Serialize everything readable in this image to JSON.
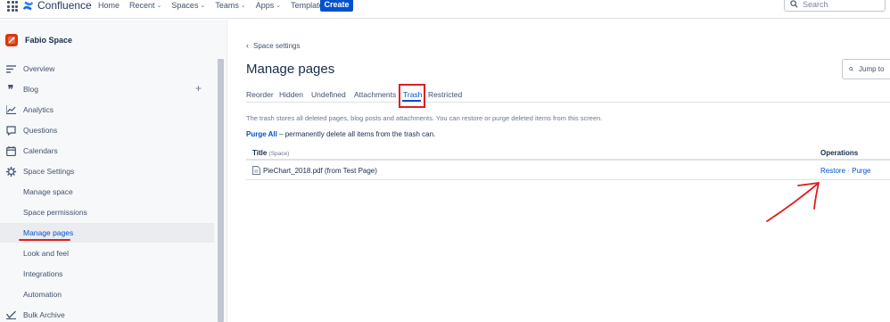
{
  "topnav": {
    "app_name": "Confluence",
    "items": [
      {
        "label": "Home",
        "dropdown": false
      },
      {
        "label": "Recent",
        "dropdown": true
      },
      {
        "label": "Spaces",
        "dropdown": true
      },
      {
        "label": "Teams",
        "dropdown": true
      },
      {
        "label": "Apps",
        "dropdown": true
      },
      {
        "label": "Templates",
        "dropdown": false
      }
    ],
    "create_label": "Create",
    "search_placeholder": "Search"
  },
  "sidebar": {
    "space_name": "Fabio Space",
    "items": [
      {
        "label": "Overview",
        "icon": "overview-icon"
      },
      {
        "label": "Blog",
        "icon": "quote-icon"
      },
      {
        "label": "Analytics",
        "icon": "analytics-icon"
      },
      {
        "label": "Questions",
        "icon": "questions-icon"
      },
      {
        "label": "Calendars",
        "icon": "calendar-icon"
      },
      {
        "label": "Space Settings",
        "icon": "gear-icon"
      },
      {
        "label": "Manage space",
        "icon": ""
      },
      {
        "label": "Space permissions",
        "icon": ""
      },
      {
        "label": "Manage pages",
        "icon": "",
        "active": true
      },
      {
        "label": "Look and feel",
        "icon": ""
      },
      {
        "label": "Integrations",
        "icon": ""
      },
      {
        "label": "Automation",
        "icon": ""
      },
      {
        "label": "Bulk Archive",
        "icon": "archive-icon"
      }
    ]
  },
  "main": {
    "breadcrumb": "Space settings",
    "title": "Manage pages",
    "jump_placeholder": "Jump to",
    "tabs": [
      {
        "label": "Reorder"
      },
      {
        "label": "Hidden"
      },
      {
        "label": "Undefined"
      },
      {
        "label": "Attachments"
      },
      {
        "label": "Trash",
        "active": true
      },
      {
        "label": "Restricted"
      }
    ],
    "description": "The trash stores all deleted pages, blog posts and attachments. You can restore or purge deleted items from this screen.",
    "purge_all_label": "Purge All",
    "purge_all_desc": " – permanently delete all items from the trash can.",
    "table": {
      "col_title": "Title",
      "col_title_sub": "(Space)",
      "col_ops": "Operations",
      "rows": [
        {
          "file": "PieChart_2018.pdf (from Test Page)",
          "restore": "Restore",
          "sep": " · ",
          "purge": "Purge"
        }
      ]
    }
  },
  "colors": {
    "accent": "#0052cc",
    "annotation_red": "#e01e1e",
    "space_avatar": "#de350b"
  }
}
